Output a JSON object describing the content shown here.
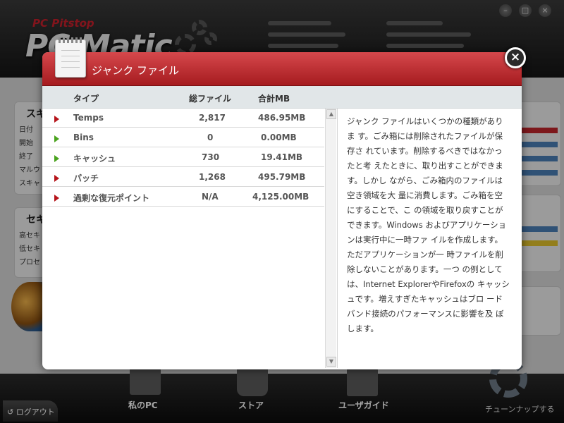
{
  "app": {
    "brand_small": "PC Pitstop",
    "brand_big": "PC Matic",
    "window_controls": [
      "–",
      "□",
      "×"
    ],
    "left_panel_1": {
      "title": "スキ",
      "lines": [
        "日付",
        "開始",
        "終了",
        "マルウ",
        "スキャ"
      ]
    },
    "left_panel_2": {
      "title": "セキ",
      "lines": [
        "高セキ",
        "低セキ",
        "プロセ"
      ]
    },
    "logout_label": "ログアウト",
    "nav": [
      {
        "label": "私のPC"
      },
      {
        "label": "ストア"
      },
      {
        "label": "ユーザガイド"
      }
    ],
    "tuneup_label": "チューンナップする"
  },
  "dialog": {
    "title": "ジャンク ファイル",
    "close_glyph": "×",
    "columns": {
      "type": "タイプ",
      "total_files": "総ファイル",
      "total_mb": "合計MB"
    },
    "rows": [
      {
        "type": "Temps",
        "files": "2,817",
        "mb": "486.95MB",
        "arrow": "red"
      },
      {
        "type": "Bins",
        "files": "0",
        "mb": "0.00MB",
        "arrow": "green"
      },
      {
        "type": "キャッシュ",
        "files": "730",
        "mb": "19.41MB",
        "arrow": "green"
      },
      {
        "type": "パッチ",
        "files": "1,268",
        "mb": "495.79MB",
        "arrow": "red"
      },
      {
        "type": "過剰な復元ポイント",
        "files": "N/A",
        "mb": "4,125.00MB",
        "arrow": "red"
      }
    ],
    "description": "ジャンク ファイルはいくつかの種類がありま す。ごみ箱には削除されたファイルが保存さ れています。削除するべきではなかったと考 えたときに、取り出すことができます。しかし ながら、ごみ箱内のファイルは空き領域を大 量に消費します。ごみ箱を空にすることで、こ の領域を取り戻すことができます。Windows およびアプリケーションは実行中に一時ファ イルを作成します。ただアプリケーションが一 時ファイルを削除しないことがあります。一つ の例としては、Internet ExplorerやFirefoxの キャッシュです。増えすぎたキャッシュはブロ ードバンド接続のパフォーマンスに影響を及 ぼします。",
    "scroll_up_glyph": "▲",
    "scroll_down_glyph": "▼"
  }
}
